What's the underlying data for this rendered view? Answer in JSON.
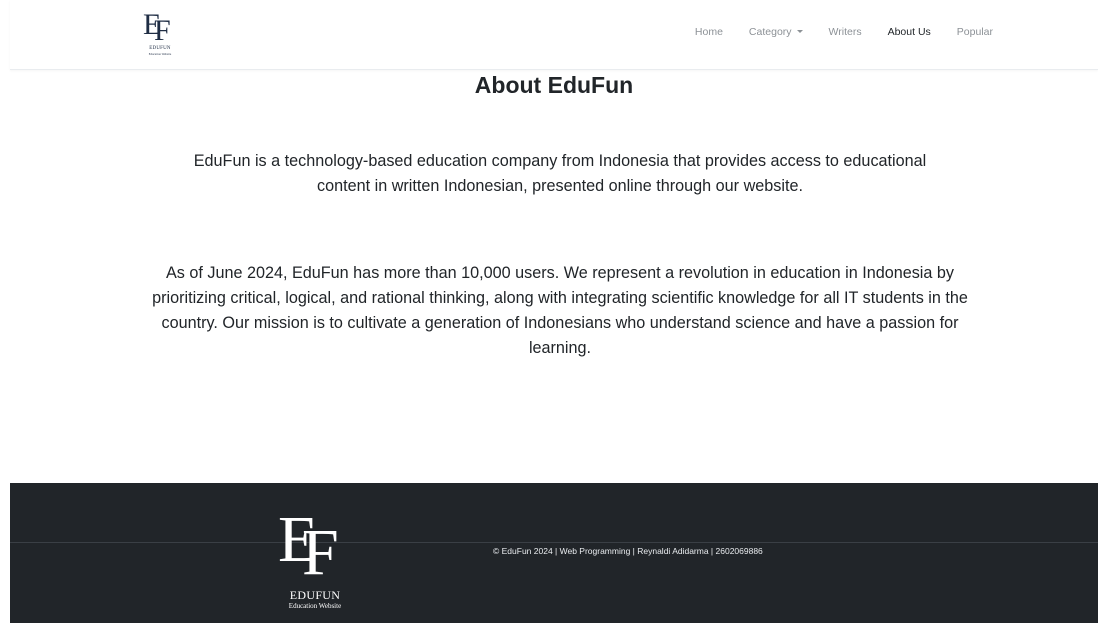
{
  "brand": {
    "logo_letters": [
      "E",
      "F"
    ],
    "name": "EDUFUN",
    "tagline": "Education Website",
    "color": "#1f2d44"
  },
  "nav": {
    "items": [
      {
        "label": "Home",
        "active": false
      },
      {
        "label": "Category",
        "active": false,
        "dropdown": true
      },
      {
        "label": "Writers",
        "active": false
      },
      {
        "label": "About Us",
        "active": true
      },
      {
        "label": "Popular",
        "active": false
      }
    ]
  },
  "main": {
    "title": "About EduFun",
    "paragraphs": [
      "EduFun is a technology-based education company from Indonesia that provides access to educational content in written Indonesian, presented online through our website.",
      "As of June 2024, EduFun has more than 10,000 users. We represent a revolution in education in Indonesia by prioritizing critical, logical, and rational thinking, along with integrating scientific knowledge for all IT students in the country. Our mission is to cultivate a generation of Indonesians who understand science and have a passion for learning."
    ]
  },
  "footer": {
    "logo_letters": [
      "E",
      "F"
    ],
    "name": "EDUFUN",
    "tagline": "Education Website",
    "copyright": "© EduFun 2024 | Web Programming | Reynaldi Adidarma | 2602069886",
    "background": "#212529"
  }
}
